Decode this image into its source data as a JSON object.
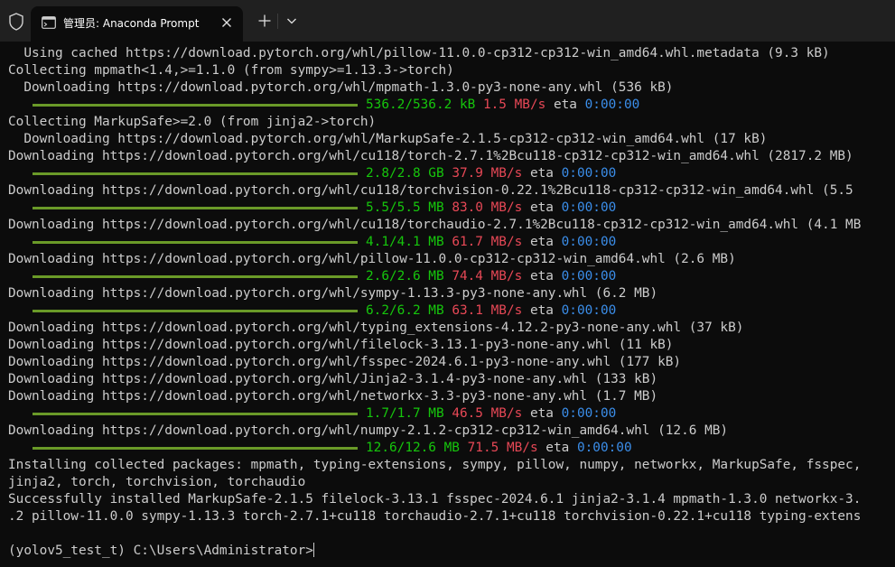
{
  "window": {
    "tab_title": "管理员: Anaconda Prompt",
    "new_tab_symbol": "+"
  },
  "colors": {
    "titlebar": "#202020",
    "background": "#0c0c0c",
    "text": "#cccccc",
    "progress_bar": "#6a9a28",
    "size_green": "#16c60c",
    "speed_red": "#e74856",
    "eta_blue": "#3b8eea"
  },
  "terminal": {
    "lines": [
      "  Using cached https://download.pytorch.org/whl/pillow-11.0.0-cp312-cp312-win_amd64.whl.metadata (9.3 kB)",
      "Collecting mpmath<1.4,>=1.1.0 (from sympy>=1.13.3->torch)",
      "  Downloading https://download.pytorch.org/whl/mpmath-1.3.0-py3-none-any.whl (536 kB)",
      null,
      "Collecting MarkupSafe>=2.0 (from jinja2->torch)",
      "  Downloading https://download.pytorch.org/whl/MarkupSafe-2.1.5-cp312-cp312-win_amd64.whl (17 kB)",
      "Downloading https://download.pytorch.org/whl/cu118/torch-2.7.1%2Bcu118-cp312-cp312-win_amd64.whl (2817.2 MB)",
      null,
      "Downloading https://download.pytorch.org/whl/cu118/torchvision-0.22.1%2Bcu118-cp312-cp312-win_amd64.whl (5.5",
      null,
      "Downloading https://download.pytorch.org/whl/cu118/torchaudio-2.7.1%2Bcu118-cp312-cp312-win_amd64.whl (4.1 MB",
      null,
      "Downloading https://download.pytorch.org/whl/pillow-11.0.0-cp312-cp312-win_amd64.whl (2.6 MB)",
      null,
      "Downloading https://download.pytorch.org/whl/sympy-1.13.3-py3-none-any.whl (6.2 MB)",
      null,
      "Downloading https://download.pytorch.org/whl/typing_extensions-4.12.2-py3-none-any.whl (37 kB)",
      "Downloading https://download.pytorch.org/whl/filelock-3.13.1-py3-none-any.whl (11 kB)",
      "Downloading https://download.pytorch.org/whl/fsspec-2024.6.1-py3-none-any.whl (177 kB)",
      "Downloading https://download.pytorch.org/whl/Jinja2-3.1.4-py3-none-any.whl (133 kB)",
      "Downloading https://download.pytorch.org/whl/networkx-3.3-py3-none-any.whl (1.7 MB)",
      null,
      "Downloading https://download.pytorch.org/whl/numpy-2.1.2-cp312-cp312-win_amd64.whl (12.6 MB)",
      null,
      "Installing collected packages: mpmath, typing-extensions, sympy, pillow, numpy, networkx, MarkupSafe, fsspec,",
      "jinja2, torch, torchvision, torchaudio",
      "Successfully installed MarkupSafe-2.1.5 filelock-3.13.1 fsspec-2024.6.1 jinja2-3.1.4 mpmath-1.3.0 networkx-3.",
      ".2 pillow-11.0.0 sympy-1.13.3 torch-2.7.1+cu118 torchaudio-2.7.1+cu118 torchvision-0.22.1+cu118 typing-extens",
      "",
      "(yolov5_test_t) C:\\Users\\Administrator>"
    ],
    "progress": [
      {
        "size": "536.2/536.2 kB",
        "speed": "1.5 MB/s",
        "eta_label": "eta",
        "eta": "0:00:00",
        "fraction": 1.0
      },
      {
        "size": "2.8/2.8 GB",
        "speed": "37.9 MB/s",
        "eta_label": "eta",
        "eta": "0:00:00",
        "fraction": 1.0
      },
      {
        "size": "5.5/5.5 MB",
        "speed": "83.0 MB/s",
        "eta_label": "eta",
        "eta": "0:00:00",
        "fraction": 1.0
      },
      {
        "size": "4.1/4.1 MB",
        "speed": "61.7 MB/s",
        "eta_label": "eta",
        "eta": "0:00:00",
        "fraction": 1.0
      },
      {
        "size": "2.6/2.6 MB",
        "speed": "74.4 MB/s",
        "eta_label": "eta",
        "eta": "0:00:00",
        "fraction": 1.0
      },
      {
        "size": "6.2/6.2 MB",
        "speed": "63.1 MB/s",
        "eta_label": "eta",
        "eta": "0:00:00",
        "fraction": 1.0
      },
      {
        "size": "1.7/1.7 MB",
        "speed": "46.5 MB/s",
        "eta_label": "eta",
        "eta": "0:00:00",
        "fraction": 1.0
      },
      {
        "size": "12.6/12.6 MB",
        "speed": "71.5 MB/s",
        "eta_label": "eta",
        "eta": "0:00:00",
        "fraction": 1.0
      }
    ]
  }
}
